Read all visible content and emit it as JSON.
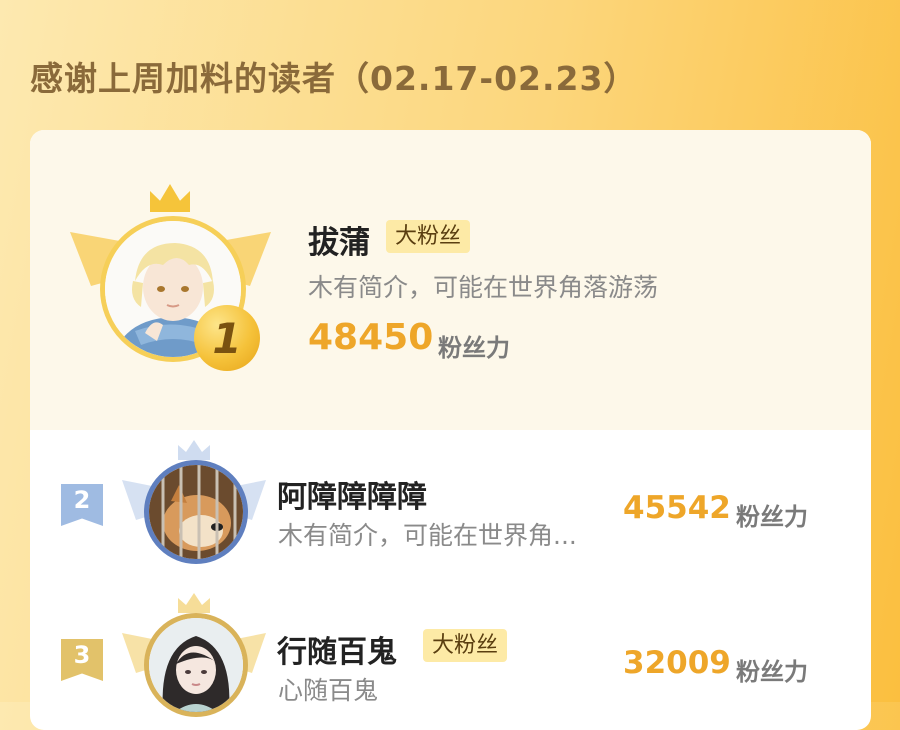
{
  "page": {
    "title": "感谢上周加料的读者（02.17-02.23）"
  },
  "readers": [
    {
      "rank": "1",
      "name": "拔蒲",
      "tag": "大粉丝",
      "intro": "木有简介，可能在世界角落游荡",
      "score": "48450",
      "score_unit": "粉丝力",
      "avatar": "anime-boy-blond-scarf"
    },
    {
      "rank": "2",
      "name": "阿障障障障",
      "tag": "",
      "intro": "木有简介，可能在世界角...",
      "score": "45542",
      "score_unit": "粉丝力",
      "avatar": "shiba-dog-in-cage"
    },
    {
      "rank": "3",
      "name": "行随百鬼",
      "tag": "大粉丝",
      "intro": "心随百鬼",
      "score": "32009",
      "score_unit": "粉丝力",
      "avatar": "ancient-style-girl"
    }
  ],
  "colors": {
    "score": "#eea629",
    "title": "#8a6a3a",
    "rank2_flag": "#9fbbe2",
    "rank3_flag": "#e2c26a"
  }
}
